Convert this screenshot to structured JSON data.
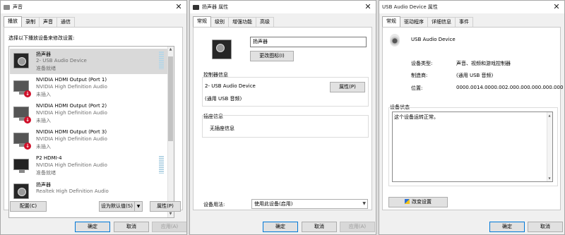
{
  "win1": {
    "title": "声音",
    "tabs": [
      "播放",
      "录制",
      "声音",
      "通信"
    ],
    "instruction": "选择以下播放设备来修改设置:",
    "devices": [
      {
        "name": "扬声器",
        "desc": "2- USB Audio Device",
        "status": "准备就绪",
        "icon": "speaker-icon",
        "selected": true
      },
      {
        "name": "NVIDIA HDMI Output (Port 1)",
        "desc": "NVIDIA High Definition Audio",
        "status": "未插入",
        "icon": "monitor-icon"
      },
      {
        "name": "NVIDIA HDMI Output (Port 2)",
        "desc": "NVIDIA High Definition Audio",
        "status": "未插入",
        "icon": "monitor-icon"
      },
      {
        "name": "NVIDIA HDMI Output (Port 3)",
        "desc": "NVIDIA High Definition Audio",
        "status": "未插入",
        "icon": "monitor-icon"
      },
      {
        "name": "P2 HDMI-4",
        "desc": "NVIDIA High Definition Audio",
        "status": "准备就绪",
        "icon": "tv-icon"
      },
      {
        "name": "扬声器",
        "desc": "Realtek High Definition Audio",
        "status": "",
        "icon": "speaker-icon"
      }
    ],
    "configure": "配置(C)",
    "set_default": "设为默认值(S)",
    "properties": "属性(P)",
    "ok": "确定",
    "cancel": "取消",
    "apply": "应用(A)"
  },
  "win2": {
    "title": "扬声器 属性",
    "tabs": [
      "常规",
      "级别",
      "增强功能",
      "高级"
    ],
    "name_value": "扬声器",
    "change_icon": "更改图标(I)",
    "controller_group": "控制器信息",
    "controller_name": "2- USB Audio Device",
    "controller_sub": "(通用 USB 音频)",
    "properties_btn": "属性(P)",
    "jack_group": "插座信息",
    "jack_info": "无插座信息",
    "usage_label": "设备用法:",
    "usage_value": "使用此设备(启用)",
    "ok": "确定",
    "cancel": "取消",
    "apply": "应用(A)"
  },
  "win3": {
    "title": "USB Audio Device 属性",
    "tabs": [
      "常规",
      "驱动程序",
      "详细信息",
      "事件"
    ],
    "device_name": "USB Audio Device",
    "rows": [
      {
        "label": "设备类型:",
        "value": "声音、视频和游戏控制器"
      },
      {
        "label": "制造商:",
        "value": "(通用 USB 音频)"
      },
      {
        "label": "位置:",
        "value": "0000.0014.0000.002.000.000.000.000.000"
      }
    ],
    "status_group": "设备状态",
    "status_text": "这个设备运转正常。",
    "change_settings": "改变设置",
    "ok": "确定",
    "cancel": "取消"
  }
}
